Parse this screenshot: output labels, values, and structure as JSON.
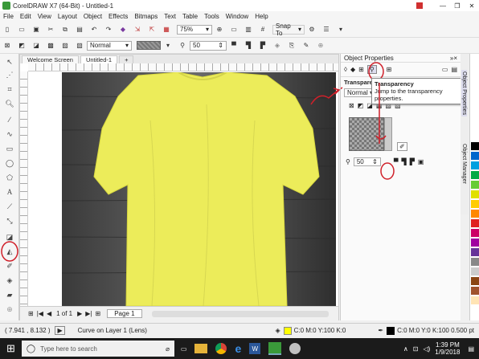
{
  "window": {
    "title": "CorelDRAW X7 (64-Bit) - Untitled-1"
  },
  "menu": [
    "File",
    "Edit",
    "View",
    "Layout",
    "Object",
    "Effects",
    "Bitmaps",
    "Text",
    "Table",
    "Tools",
    "Window",
    "Help"
  ],
  "toolbar1": {
    "zoom": "75%",
    "snap": "Snap To"
  },
  "toolbar2": {
    "mode": "Normal",
    "transparency": "50"
  },
  "doc_tabs": [
    "Welcome Screen",
    "Untitled-1"
  ],
  "page_nav": {
    "page_count": "1 of 1",
    "page_tab": "Page 1"
  },
  "properties": {
    "title": "Object Properties",
    "section": "Transparency",
    "mode": "Normal",
    "value": "50",
    "tooltip_title": "Transparency",
    "tooltip_text": "Jump to the transparency properties."
  },
  "side_tabs": [
    "Object Properties",
    "Object Manager"
  ],
  "palette_colors": [
    "#ffffff",
    "#000000",
    "#0066cc",
    "#00a0e0",
    "#00aa44",
    "#66cc33",
    "#e0e000",
    "#ffcc00",
    "#ff8800",
    "#e02020",
    "#cc0066",
    "#a000a0",
    "#663399",
    "#888888",
    "#cccccc",
    "#8b4513",
    "#a0522d",
    "#ffe4b5"
  ],
  "status": {
    "coords": "( 7.941 , 8.132 )",
    "info": "Curve on Layer 1 (Lens)",
    "fill": "C:0 M:0 Y:100 K:0",
    "outline": "C:0 M:0 Y:0 K:100 0.500 pt"
  },
  "taskbar": {
    "search_placeholder": "Type here to search",
    "time": "1:39 PM",
    "date": "1/9/2018"
  },
  "colors": {
    "shirt": "#ecec5a",
    "annotation": "#d0202a",
    "taskbar": "#1b1b1b"
  }
}
